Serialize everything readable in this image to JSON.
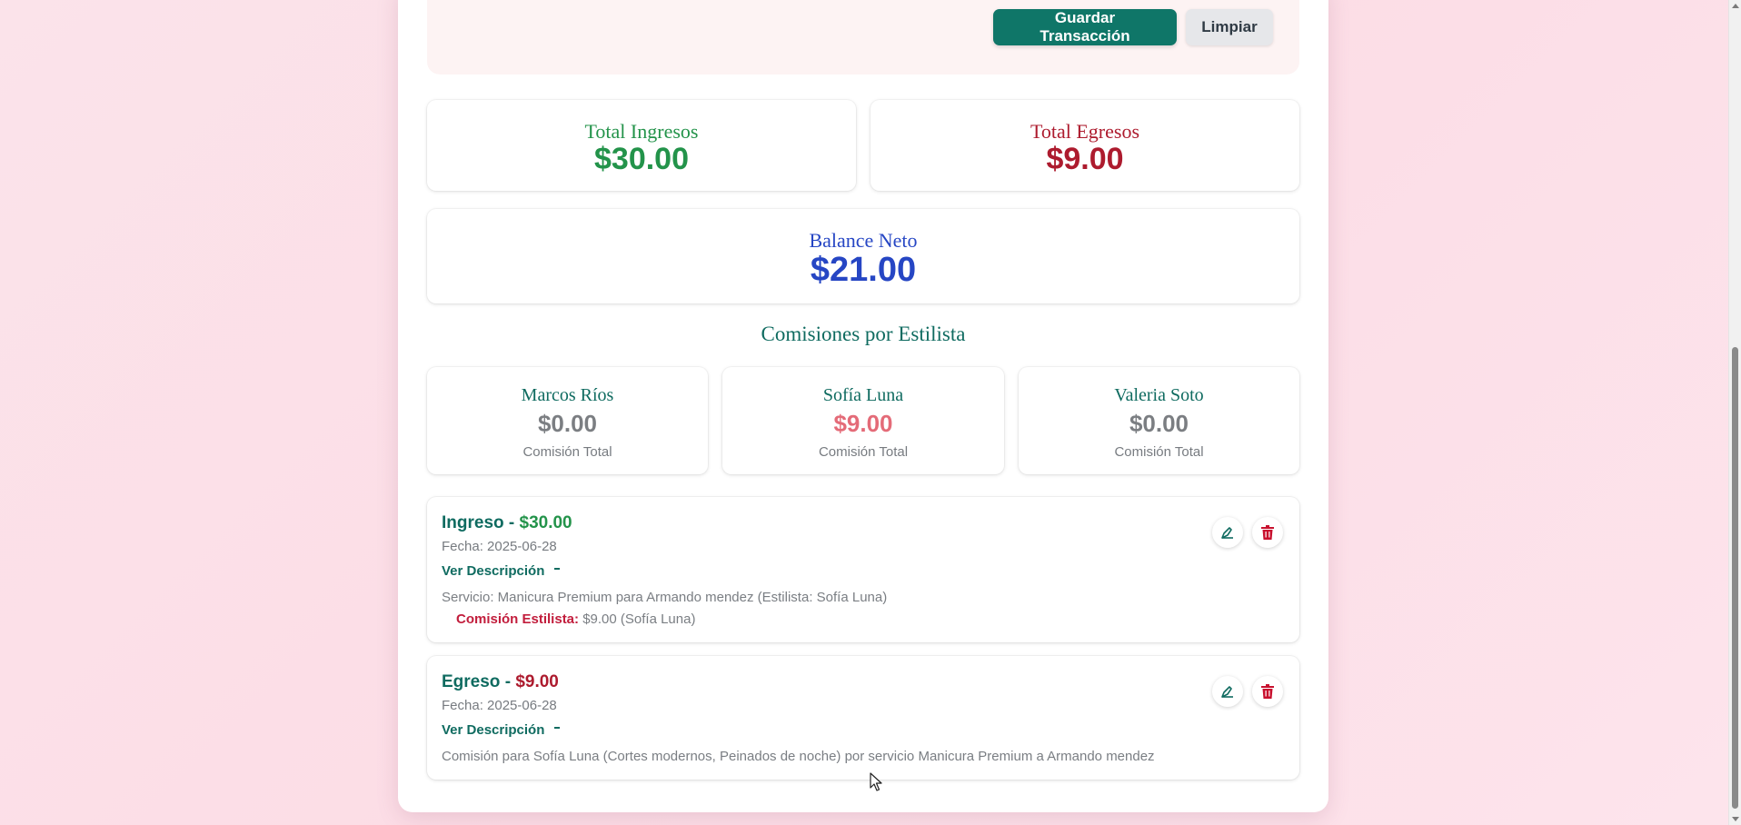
{
  "form": {
    "save_label": "Guardar Transacción",
    "clear_label": "Limpiar"
  },
  "summary": {
    "income_label": "Total Ingresos",
    "income_value": "$30.00",
    "expense_label": "Total Egresos",
    "expense_value": "$9.00",
    "balance_label": "Balance Neto",
    "balance_value": "$21.00"
  },
  "commissions": {
    "title": "Comisiones por Estilista",
    "stylists": [
      {
        "name": "Marcos Ríos",
        "amount": "$0.00",
        "caption": "Comisión Total"
      },
      {
        "name": "Sofía Luna",
        "amount": "$9.00",
        "caption": "Comisión Total"
      },
      {
        "name": "Valeria Soto",
        "amount": "$0.00",
        "caption": "Comisión Total"
      }
    ]
  },
  "transactions": [
    {
      "type": "Ingreso -",
      "amount": "$30.00",
      "date": "Fecha: 2025-06-28",
      "toggle": "Ver Descripción",
      "description": "Servicio: Manicura Premium para Armando mendez (Estilista: Sofía Luna)",
      "commission_label": "Comisión Estilista:",
      "commission_value": "$9.00 (Sofía Luna)"
    },
    {
      "type": "Egreso -",
      "amount": "$9.00",
      "date": "Fecha: 2025-06-28",
      "toggle": "Ver Descripción",
      "description": "Comisión para Sofía Luna (Cortes modernos, Peinados de noche) por servicio Manicura Premium a Armando mendez"
    }
  ],
  "colors": {
    "primary": "#0f7668",
    "income": "#23934a",
    "expense": "#ad1b2e",
    "balance": "#2646c4",
    "commission_active": "#e46b78",
    "commission_zero": "#7b7e82",
    "delete": "#c8102e"
  },
  "icons": {
    "edit": "edit-icon",
    "delete": "trash-icon",
    "chevron": "chevron-down-icon"
  }
}
